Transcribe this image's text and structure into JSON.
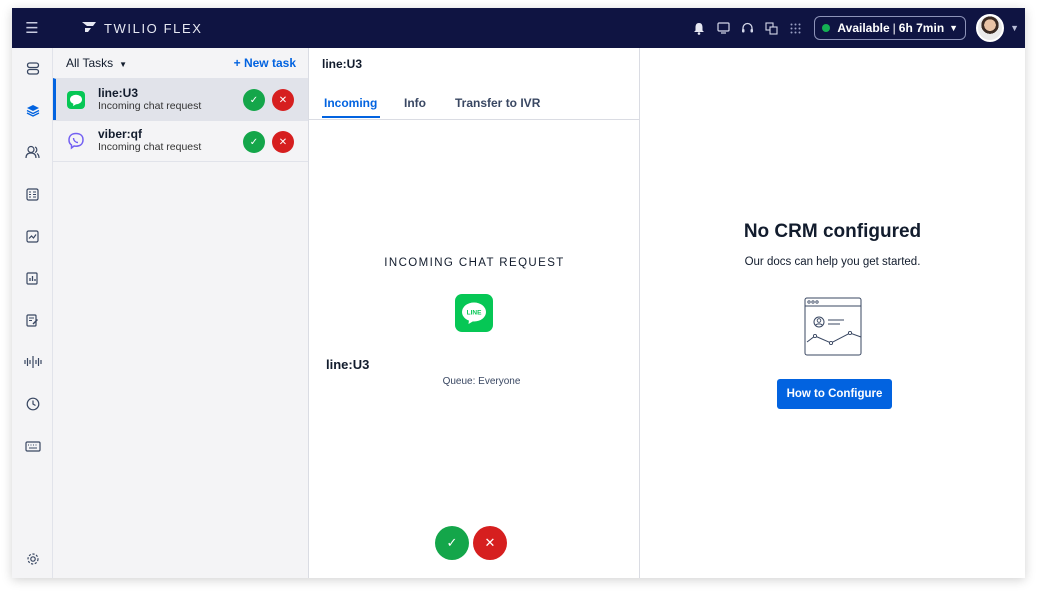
{
  "topbar": {
    "brand": "TWILIO FLEX",
    "status_label": "Available",
    "status_time": "6h 7min",
    "status_color": "#14b053",
    "icons": [
      "bell-icon",
      "monitor-icon",
      "headset-icon",
      "translate-icon",
      "grid-icon"
    ]
  },
  "rail": {
    "items": [
      "switch-icon",
      "layers-icon",
      "agents-icon",
      "queue-icon",
      "chart-icon",
      "report-icon",
      "notes-icon",
      "audio-icon",
      "clock-icon",
      "keyboard-icon"
    ],
    "bottom": "settings-icon"
  },
  "tasklist": {
    "filter_label": "All Tasks",
    "new_task_label": "+ New task",
    "tasks": [
      {
        "name": "line:U3",
        "subtitle": "Incoming chat request",
        "channel": "line"
      },
      {
        "name": "viber:qf",
        "subtitle": "Incoming chat request",
        "channel": "viber"
      }
    ]
  },
  "task_panel": {
    "title": "line:U3",
    "tabs": [
      "Incoming",
      "Info",
      "Transfer to IVR"
    ],
    "active_tab": "Incoming",
    "incoming_label": "INCOMING CHAT REQUEST",
    "logo_text": "LINE",
    "task_name": "line:U3",
    "queue": "Queue: Everyone"
  },
  "crm": {
    "title": "No CRM configured",
    "subtitle": "Our docs can help you get started.",
    "button_label": "How to Configure"
  },
  "colors": {
    "accent": "#0263e0",
    "topbar": "#0f1442",
    "accept": "#14a64a",
    "reject": "#d61f1f",
    "line_green": "#06c755",
    "viber_purple": "#7360f2"
  }
}
